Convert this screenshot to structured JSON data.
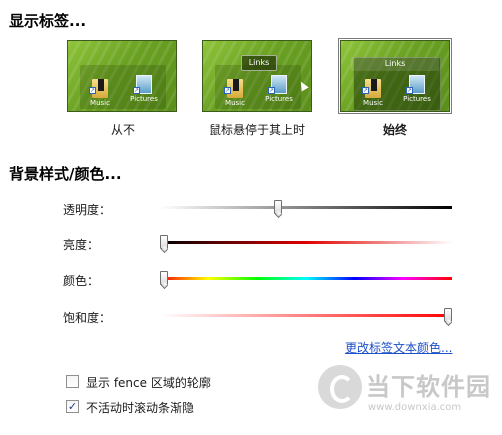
{
  "sections": {
    "show_labels_heading": "显示标签...",
    "background_heading": "背景样式/颜色..."
  },
  "previews": [
    {
      "caption": "从不",
      "selected": false,
      "icons": [
        "Music",
        "Pictures"
      ],
      "fence_title": ""
    },
    {
      "caption": "鼠标悬停于其上时",
      "selected": false,
      "icons": [
        "Music",
        "Pictures"
      ],
      "fence_title": "Links"
    },
    {
      "caption": "始终",
      "selected": true,
      "icons": [
        "Music",
        "Pictures"
      ],
      "fence_title": "Links"
    }
  ],
  "sliders": [
    {
      "label": "透明度：",
      "value_fraction": 0.4,
      "gradient": [
        "#ffffff",
        "#000000"
      ]
    },
    {
      "label": "亮度：",
      "value_fraction": 0.0,
      "gradient": [
        "#000000",
        "#e00000",
        "#ffffff"
      ]
    },
    {
      "label": "颜色：",
      "value_fraction": 0.0,
      "gradient": [
        "#ff0000",
        "#ffff00",
        "#00ff00",
        "#00ffff",
        "#0000ff",
        "#ff00ff",
        "#ff0000"
      ]
    },
    {
      "label": "饱和度：",
      "value_fraction": 1.0,
      "gradient": [
        "#ffffff",
        "#ff0000"
      ]
    }
  ],
  "link_label": "更改标签文本颜色...",
  "checkboxes": [
    {
      "label": "显示 fence 区域的轮廓",
      "checked": false
    },
    {
      "label": "不活动时滚动条渐隐",
      "checked": true
    }
  ],
  "watermark": {
    "title": "当下软件园",
    "url": "www.downxia.com"
  }
}
